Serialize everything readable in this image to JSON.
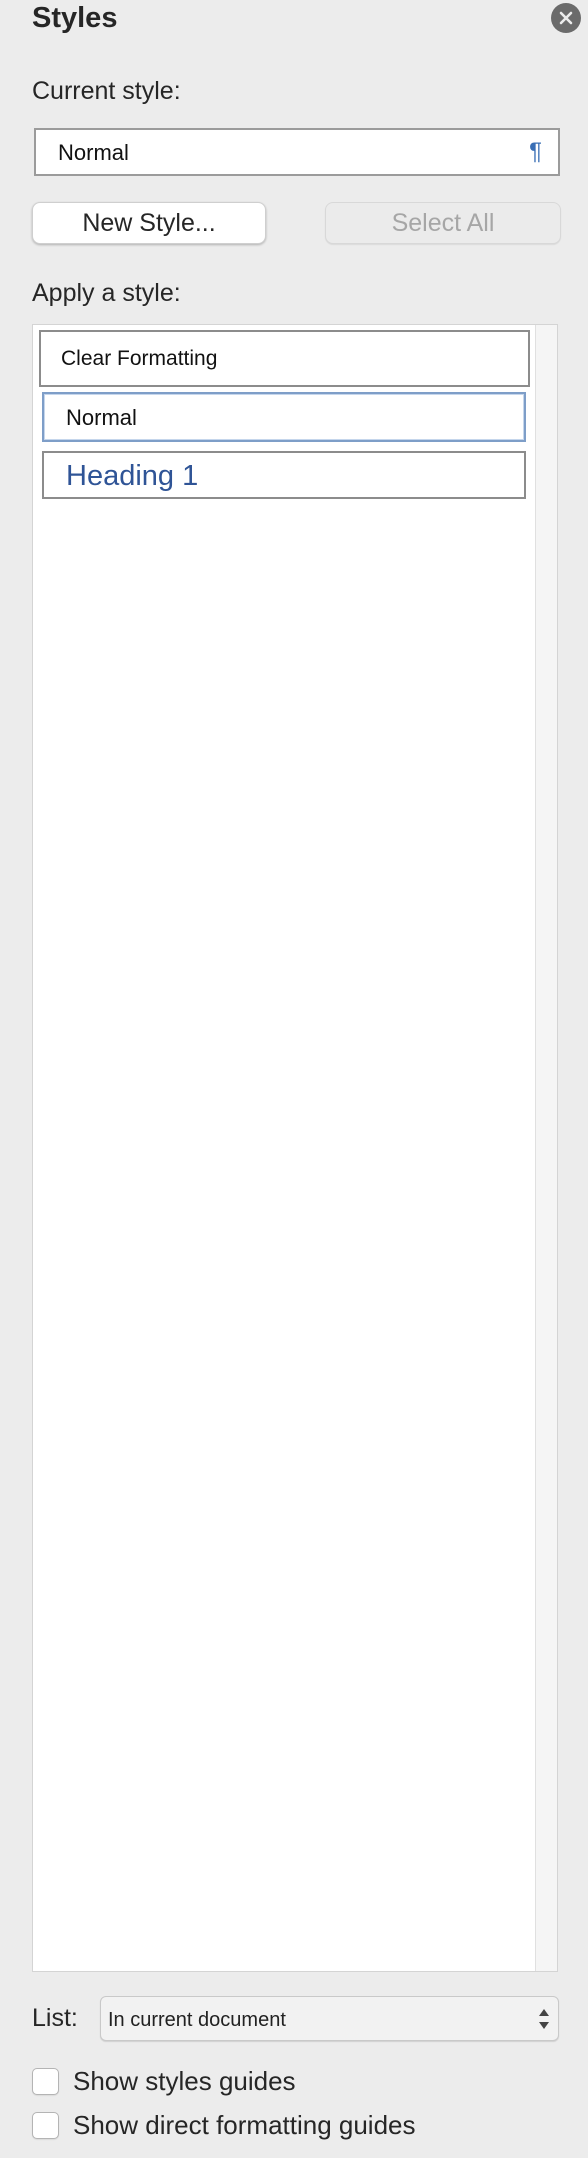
{
  "panel": {
    "title": "Styles",
    "close_icon": "close-icon"
  },
  "current_style": {
    "label": "Current style:",
    "value": "Normal",
    "pilcrow": "¶"
  },
  "buttons": {
    "new_style": "New Style...",
    "select_all": "Select All"
  },
  "apply": {
    "label": "Apply a style:",
    "items": [
      {
        "label": "Clear Formatting"
      },
      {
        "label": "Normal"
      },
      {
        "label": "Heading 1",
        "color": "#2f5496"
      }
    ]
  },
  "list": {
    "label": "List:",
    "selected": "In current document"
  },
  "options": {
    "show_styles_guides": "Show styles guides",
    "show_direct_formatting_guides": "Show direct formatting guides"
  },
  "colors": {
    "accent": "#3a6fb5",
    "heading": "#2f5496"
  }
}
